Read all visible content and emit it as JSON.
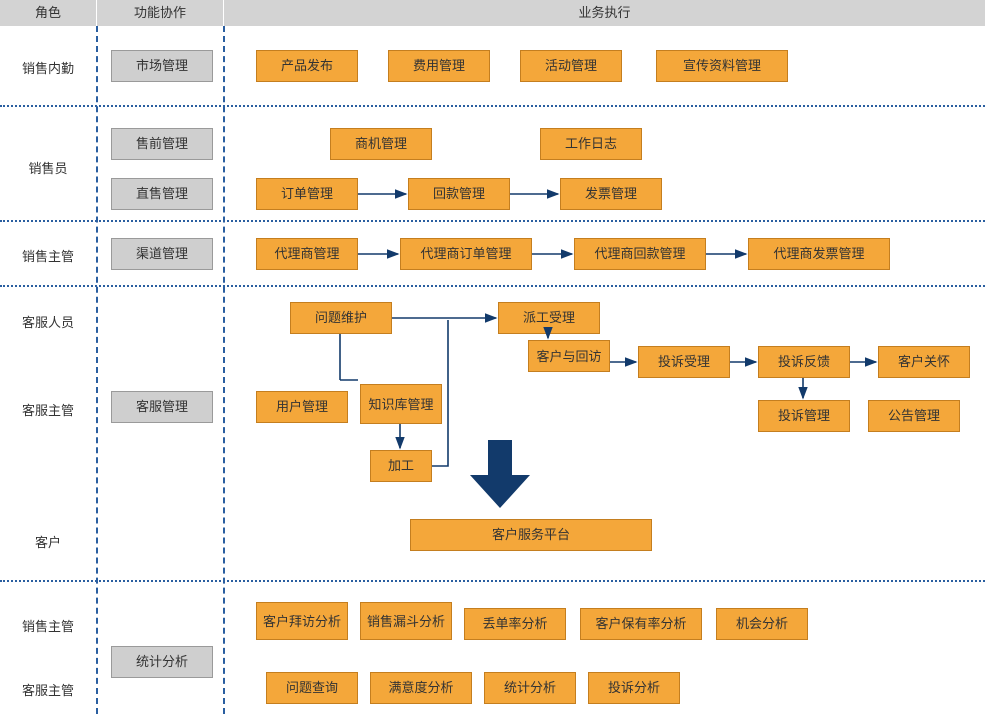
{
  "headers": {
    "role": "角色",
    "func": "功能协作",
    "exec": "业务执行"
  },
  "roles": {
    "r1": "销售内勤",
    "r2": "销售员",
    "r3": "销售主管",
    "r4": "客服人员",
    "r5": "客服主管",
    "r6": "客户",
    "r7": "销售主管",
    "r8": "客服主管"
  },
  "func": {
    "market": "市场管理",
    "presale": "售前管理",
    "direct": "直售管理",
    "channel": "渠道管理",
    "service": "客服管理",
    "stats": "统计分析"
  },
  "row1": {
    "a": "产品发布",
    "b": "费用管理",
    "c": "活动管理",
    "d": "宣传资料管理"
  },
  "row2": {
    "opp": "商机管理",
    "log": "工作日志",
    "order": "订单管理",
    "pay": "回款管理",
    "inv": "发票管理"
  },
  "row3": {
    "a": "代理商管理",
    "b": "代理商订单管理",
    "c": "代理商回款管理",
    "d": "代理商发票管理"
  },
  "svc": {
    "issue": "问题维护",
    "dispatch": "派工受理",
    "visit": "客户与回访",
    "compAccept": "投诉受理",
    "compFeedback": "投诉反馈",
    "care": "客户关怀",
    "user": "用户管理",
    "kb": "知识库管理",
    "proc": "加工",
    "compMgmt": "投诉管理",
    "notice": "公告管理",
    "platform": "客户服务平台"
  },
  "ana1": {
    "a": "客户拜访分析",
    "b": "销售漏斗分析",
    "c": "丢单率分析",
    "d": "客户保有率分析",
    "e": "机会分析"
  },
  "ana2": {
    "a": "问题查询",
    "b": "满意度分析",
    "c": "统计分析",
    "d": "投诉分析"
  }
}
